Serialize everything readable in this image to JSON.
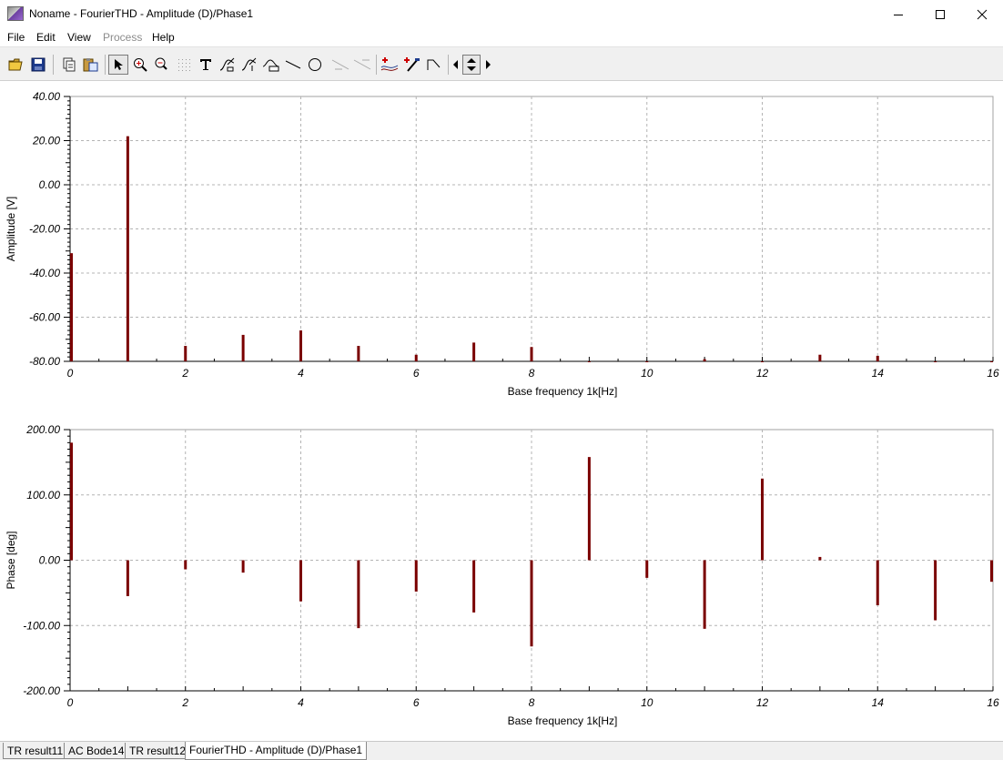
{
  "window": {
    "title": "Noname - FourierTHD - Amplitude (D)/Phase1",
    "minimize_icon": "minimize-icon",
    "maximize_icon": "maximize-icon",
    "close_icon": "close-icon"
  },
  "menu": [
    {
      "label": "File",
      "enabled": true
    },
    {
      "label": "Edit",
      "enabled": true
    },
    {
      "label": "View",
      "enabled": true
    },
    {
      "label": "Process",
      "enabled": false
    },
    {
      "label": "Help",
      "enabled": true
    }
  ],
  "toolbar_icons": [
    "open-folder-icon",
    "save-icon",
    "copy-icon",
    "paste-icon",
    "pointer-icon",
    "zoom-in-icon",
    "zoom-100-icon",
    "grid-icon",
    "text-icon",
    "curve-label-icon",
    "curve-marker-icon",
    "band-icon",
    "line-icon",
    "circle-icon",
    "slope-icon",
    "slope-alt-icon",
    "add-curve-icon",
    "add-marker-icon",
    "cursor-icon",
    "arrow-left-icon",
    "arrow-up-down-icon",
    "arrow-right-icon"
  ],
  "colors": {
    "series": "#7a0000",
    "grid": "#b4b4b4",
    "background": "#ffffff"
  },
  "chart_data": [
    {
      "type": "bar",
      "ylabel": "Amplitude [V]",
      "xlabel": "Base frequency 1k[Hz]",
      "xlim": [
        0,
        16
      ],
      "ylim": [
        -80,
        40
      ],
      "x_ticks": [
        "0",
        "2",
        "4",
        "6",
        "8",
        "10",
        "12",
        "14",
        "16"
      ],
      "y_ticks": [
        "40.00",
        "20.00",
        "0.00",
        "-20.00",
        "-40.00",
        "-60.00",
        "-80.00"
      ],
      "grid": true,
      "baseline": -80,
      "x": [
        0,
        1,
        2,
        3,
        4,
        5,
        6,
        7,
        8,
        9,
        10,
        11,
        12,
        13,
        14,
        15,
        16
      ],
      "values": [
        -31,
        22,
        -73,
        -68,
        -66,
        -73,
        -77,
        -71.5,
        -73.5,
        -80,
        -80,
        -79,
        -80,
        -77,
        -77.5,
        -80,
        -80
      ]
    },
    {
      "type": "bar",
      "ylabel": "Phase [deg]",
      "xlabel": "Base frequency 1k[Hz]",
      "xlim": [
        0,
        16
      ],
      "ylim": [
        -200,
        200
      ],
      "x_ticks": [
        "0",
        "2",
        "4",
        "6",
        "8",
        "10",
        "12",
        "14",
        "16"
      ],
      "y_ticks": [
        "200.00",
        "100.00",
        "0.00",
        "-100.00",
        "-200.00"
      ],
      "grid": true,
      "baseline": 0,
      "x": [
        0,
        1,
        2,
        3,
        4,
        5,
        6,
        7,
        8,
        9,
        10,
        11,
        12,
        13,
        14,
        15,
        16
      ],
      "values": [
        180,
        -55,
        -14,
        -19,
        -63,
        -104,
        -48,
        -80,
        -132,
        158,
        -27,
        -105,
        125,
        5,
        -69,
        -92,
        -33
      ]
    }
  ],
  "tabs": [
    {
      "label": "TR result11",
      "active": false
    },
    {
      "label": "AC Bode14",
      "active": false
    },
    {
      "label": "TR result12",
      "active": false
    },
    {
      "label": "FourierTHD - Amplitude (D)/Phase1",
      "active": true
    }
  ]
}
